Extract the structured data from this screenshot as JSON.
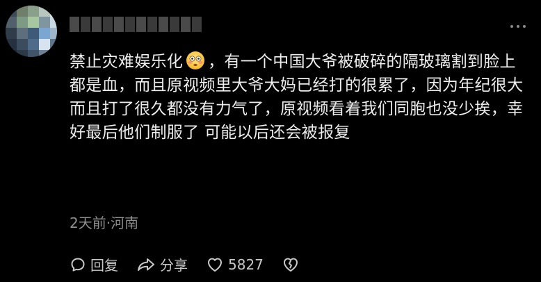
{
  "comment": {
    "text_before_emoji": "禁止灾难娱乐化",
    "emoji_name": "flushed-face-emoji",
    "text_after_emoji": "，有一个中国大爷被破碎的隔玻璃割到脸上都是血，而且原视频里大爷大妈已经打的很累了，因为年纪很大而且打了很久都没有力气了，原视频看着我们同胞也没少挨，幸好最后他们制服了  可能以后还会被报复"
  },
  "meta": {
    "time_location": "2天前·河南"
  },
  "actions": {
    "reply_label": "回复",
    "share_label": "分享",
    "like_count": "5827"
  },
  "icons": {
    "reply": "reply-bubble-icon",
    "share": "share-arrow-icon",
    "like": "heart-icon",
    "dislike": "broken-heart-icon",
    "more": "more-dots-icon"
  }
}
